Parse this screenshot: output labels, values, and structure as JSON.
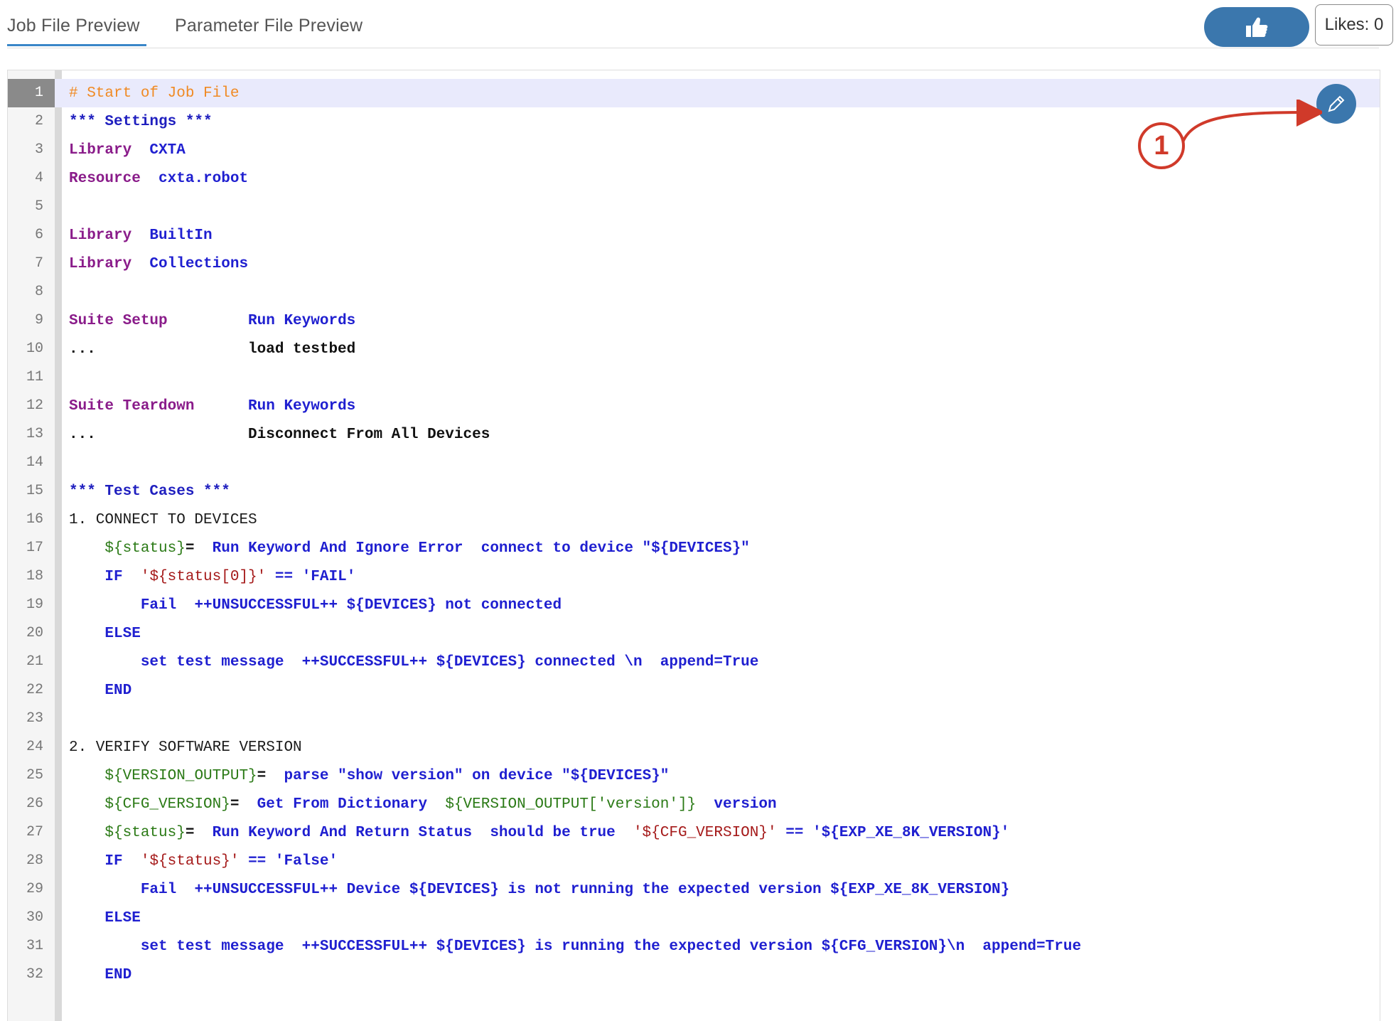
{
  "tabs": [
    {
      "label": "Job File Preview",
      "active": true
    },
    {
      "label": "Parameter File Preview",
      "active": false
    }
  ],
  "likes": {
    "label": "Likes: 0",
    "icon": "thumbs-up-icon"
  },
  "edit": {
    "icon": "pencil-icon"
  },
  "annotation": {
    "number": "1"
  },
  "colors": {
    "accent": "#3b77ad",
    "annotation": "#d03a2a",
    "current_line": "#e9eafc"
  },
  "editor": {
    "current_line": 1,
    "lines": [
      {
        "n": "1",
        "t": [
          {
            "c": "t-comment",
            "s": "# Start of Job File"
          }
        ]
      },
      {
        "n": "2",
        "t": [
          {
            "c": "t-head",
            "s": "*** Settings ***"
          }
        ]
      },
      {
        "n": "3",
        "t": [
          {
            "c": "t-set",
            "s": "Library  "
          },
          {
            "c": "t-kw",
            "s": "CXTA"
          }
        ]
      },
      {
        "n": "4",
        "t": [
          {
            "c": "t-set",
            "s": "Resource  "
          },
          {
            "c": "t-kw",
            "s": "cxta.robot"
          }
        ]
      },
      {
        "n": "5",
        "t": []
      },
      {
        "n": "6",
        "t": [
          {
            "c": "t-set",
            "s": "Library  "
          },
          {
            "c": "t-kw",
            "s": "BuiltIn"
          }
        ]
      },
      {
        "n": "7",
        "t": [
          {
            "c": "t-set",
            "s": "Library  "
          },
          {
            "c": "t-kw",
            "s": "Collections"
          }
        ]
      },
      {
        "n": "8",
        "t": []
      },
      {
        "n": "9",
        "t": [
          {
            "c": "t-set",
            "s": "Suite Setup         "
          },
          {
            "c": "t-kw",
            "s": "Run Keywords"
          }
        ]
      },
      {
        "n": "10",
        "t": [
          {
            "c": "t-txt",
            "s": "...                 load testbed"
          }
        ]
      },
      {
        "n": "11",
        "t": []
      },
      {
        "n": "12",
        "t": [
          {
            "c": "t-set",
            "s": "Suite Teardown      "
          },
          {
            "c": "t-kw",
            "s": "Run Keywords"
          }
        ]
      },
      {
        "n": "13",
        "t": [
          {
            "c": "t-txt",
            "s": "...                 Disconnect From All Devices"
          }
        ]
      },
      {
        "n": "14",
        "t": []
      },
      {
        "n": "15",
        "t": [
          {
            "c": "t-head",
            "s": "*** Test Cases ***"
          }
        ]
      },
      {
        "n": "16",
        "t": [
          {
            "c": "plain",
            "s": "1. CONNECT TO DEVICES"
          }
        ]
      },
      {
        "n": "17",
        "t": [
          {
            "c": "plain",
            "s": "    "
          },
          {
            "c": "t-var",
            "s": "${status}"
          },
          {
            "c": "t-txt",
            "s": "=  "
          },
          {
            "c": "t-kw",
            "s": "Run Keyword And Ignore Error  connect to device \"${DEVICES}\""
          }
        ]
      },
      {
        "n": "18",
        "t": [
          {
            "c": "plain",
            "s": "    "
          },
          {
            "c": "t-ctl",
            "s": "IF  "
          },
          {
            "c": "t-str",
            "s": "'${status[0]}'"
          },
          {
            "c": "t-kw",
            "s": " == 'FAIL'"
          }
        ]
      },
      {
        "n": "19",
        "t": [
          {
            "c": "plain",
            "s": "        "
          },
          {
            "c": "t-kw",
            "s": "Fail  ++UNSUCCESSFUL++ ${DEVICES} not connected"
          }
        ]
      },
      {
        "n": "20",
        "t": [
          {
            "c": "plain",
            "s": "    "
          },
          {
            "c": "t-ctl",
            "s": "ELSE"
          }
        ]
      },
      {
        "n": "21",
        "t": [
          {
            "c": "plain",
            "s": "        "
          },
          {
            "c": "t-kw",
            "s": "set test message  ++SUCCESSFUL++ ${DEVICES} connected \\n  append=True"
          }
        ]
      },
      {
        "n": "22",
        "t": [
          {
            "c": "plain",
            "s": "    "
          },
          {
            "c": "t-ctl",
            "s": "END"
          }
        ]
      },
      {
        "n": "23",
        "t": []
      },
      {
        "n": "24",
        "t": [
          {
            "c": "plain",
            "s": "2. VERIFY SOFTWARE VERSION"
          }
        ]
      },
      {
        "n": "25",
        "t": [
          {
            "c": "plain",
            "s": "    "
          },
          {
            "c": "t-var",
            "s": "${VERSION_OUTPUT}"
          },
          {
            "c": "t-txt",
            "s": "=  "
          },
          {
            "c": "t-kw",
            "s": "parse \"show version\" on device \"${DEVICES}\""
          }
        ]
      },
      {
        "n": "26",
        "t": [
          {
            "c": "plain",
            "s": "    "
          },
          {
            "c": "t-var",
            "s": "${CFG_VERSION}"
          },
          {
            "c": "t-txt",
            "s": "=  "
          },
          {
            "c": "t-kw",
            "s": "Get From Dictionary  "
          },
          {
            "c": "t-var",
            "s": "${VERSION_OUTPUT['version']}"
          },
          {
            "c": "t-kw",
            "s": "  version"
          }
        ]
      },
      {
        "n": "27",
        "t": [
          {
            "c": "plain",
            "s": "    "
          },
          {
            "c": "t-var",
            "s": "${status}"
          },
          {
            "c": "t-txt",
            "s": "=  "
          },
          {
            "c": "t-kw",
            "s": "Run Keyword And Return Status  should be true  "
          },
          {
            "c": "t-str",
            "s": "'${CFG_VERSION}'"
          },
          {
            "c": "t-kw",
            "s": " == '${EXP_XE_8K_VERSION}'"
          }
        ]
      },
      {
        "n": "28",
        "t": [
          {
            "c": "plain",
            "s": "    "
          },
          {
            "c": "t-ctl",
            "s": "IF  "
          },
          {
            "c": "t-str",
            "s": "'${status}'"
          },
          {
            "c": "t-kw",
            "s": " == 'False'"
          }
        ]
      },
      {
        "n": "29",
        "t": [
          {
            "c": "plain",
            "s": "        "
          },
          {
            "c": "t-kw",
            "s": "Fail  ++UNSUCCESSFUL++ Device ${DEVICES} is not running the expected version ${EXP_XE_8K_VERSION}"
          }
        ]
      },
      {
        "n": "30",
        "t": [
          {
            "c": "plain",
            "s": "    "
          },
          {
            "c": "t-ctl",
            "s": "ELSE"
          }
        ]
      },
      {
        "n": "31",
        "t": [
          {
            "c": "plain",
            "s": "        "
          },
          {
            "c": "t-kw",
            "s": "set test message  ++SUCCESSFUL++ ${DEVICES} is running the expected version ${CFG_VERSION}\\n  append=True"
          }
        ]
      },
      {
        "n": "32",
        "t": [
          {
            "c": "plain",
            "s": "    "
          },
          {
            "c": "t-ctl",
            "s": "END"
          }
        ]
      }
    ]
  }
}
